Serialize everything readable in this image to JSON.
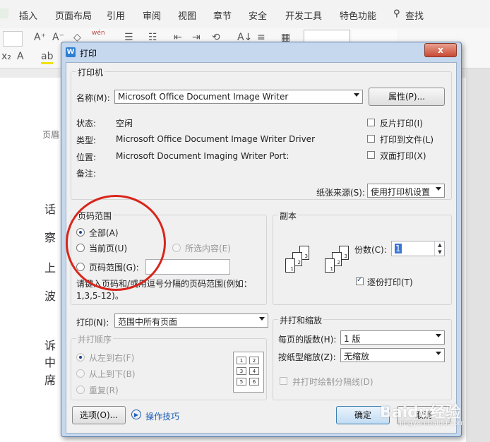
{
  "app": {
    "ribbon_tabs": [
      "插入",
      "页面布局",
      "引用",
      "审阅",
      "视图",
      "章节",
      "安全",
      "开发工具",
      "特色功能",
      "查找"
    ],
    "doc_chars": [
      "页眉",
      "话",
      "察",
      "上",
      "波",
      "诉",
      "中",
      "席"
    ]
  },
  "dialog": {
    "title": "打印",
    "close_glyph": "x",
    "printer": {
      "group_label": "打印机",
      "name_label": "名称(M):",
      "name_value": "Microsoft Office Document Image Writer",
      "properties_button": "属性(P)...",
      "status_label": "状态:",
      "status_value": "空闲",
      "type_label": "类型:",
      "type_value": "Microsoft Office Document Image Writer Driver",
      "where_label": "位置:",
      "where_value": "Microsoft Document Imaging Writer Port:",
      "comment_label": "备注:",
      "reverse_print": "反片打印(I)",
      "print_to_file": "打印到文件(L)",
      "duplex": "双面打印(X)",
      "paper_source_label": "纸张来源(S):",
      "paper_source_value": "使用打印机设置"
    },
    "page_range": {
      "group_label": "页码范围",
      "all": "全部(A)",
      "current": "当前页(U)",
      "selection": "所选内容(E)",
      "pages": "页码范围(G):",
      "pages_value": "",
      "hint": "请键入页码和/或用逗号分隔的页码范围(例如：1,3,5-12)。"
    },
    "copies": {
      "group_label": "副本",
      "count_label": "份数(C):",
      "count_value": "1",
      "collate": "逐份打印(T)"
    },
    "print_what": {
      "label": "打印(N):",
      "value": "范围中所有页面"
    },
    "order": {
      "group_label": "并打顺序",
      "left_to_right": "从左到右(F)",
      "top_to_bottom": "从上到下(B)",
      "repeat": "重复(R)"
    },
    "zoom": {
      "group_label": "并打和缩放",
      "pages_per_sheet_label": "每页的版数(H):",
      "pages_per_sheet_value": "1 版",
      "scale_label": "按纸型缩放(Z):",
      "scale_value": "无缩放",
      "draw_lines": "并打时绘制分隔线(D)"
    },
    "footer": {
      "options_button": "选项(O)...",
      "tips_link": "操作技巧",
      "ok_button": "确定",
      "cancel_button": "取消"
    }
  },
  "watermark": {
    "text": "Baidu经验",
    "sub": "jingyan.baidu.com"
  },
  "colors": {
    "annotation_circle": "#d9261c",
    "dialog_frame": "#c6d8ee"
  }
}
